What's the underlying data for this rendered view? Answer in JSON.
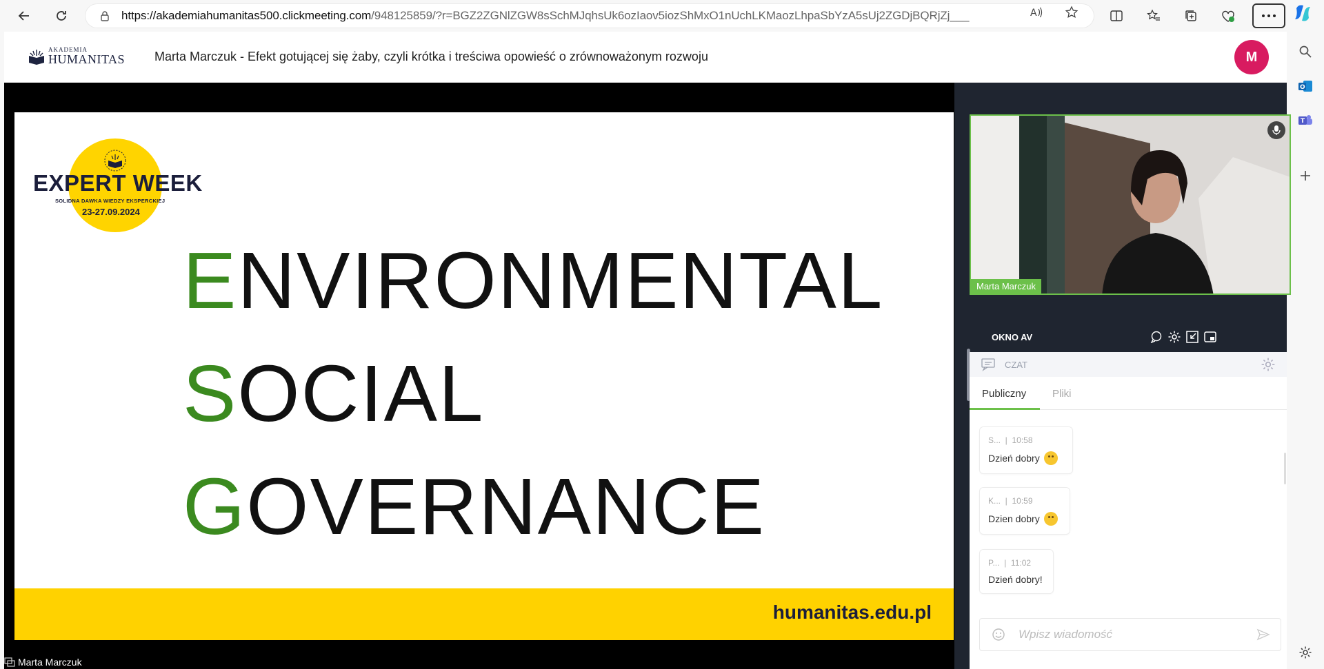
{
  "browser": {
    "url_host": "https://akademiahumanitas500.clickmeeting.com",
    "url_path": "/948125859/?r=BGZ2ZGNlZGW8sSchMJqhsUk6ozIaov5iozShMxO1nUchLKMaozLhpaSbYzA5sUj2ZGDjBQRjZj___"
  },
  "header": {
    "logo_line1": "AKADEMIA",
    "logo_line2": "HUMANITAS",
    "title": "Marta Marczuk - Efekt gotującej się żaby, czyli krótka i treściwa opowieść o zrównoważonym rozwoju",
    "avatar_initial": "M"
  },
  "slide": {
    "badge_title": "EXPERT WEEK",
    "badge_subtitle": "SOLIDNA DAWKA WIEDZY EKSPERCKIEJ",
    "badge_dates": "23-27.09.2024",
    "line1_initial": "E",
    "line1_rest": "NVIRONMENTAL",
    "line2_initial": "S",
    "line2_rest": "OCIAL",
    "line3_initial": "G",
    "line3_rest": "OVERNANCE",
    "website": "humanitas.edu.pl",
    "presenter_label": "Marta Marczuk"
  },
  "video": {
    "participant_name": "Marta Marczuk"
  },
  "av_panel": {
    "label": "OKNO AV"
  },
  "chat": {
    "header_label": "CZAT",
    "tabs": [
      {
        "label": "Publiczny"
      },
      {
        "label": "Pliki"
      }
    ],
    "messages": [
      {
        "author": "S...",
        "time": "10:58",
        "text": "Dzień dobry"
      },
      {
        "author": "K...",
        "time": "10:59",
        "text": "Dzien dobry"
      },
      {
        "author": "P...",
        "time": "11:02",
        "text": "Dzień dobry!"
      }
    ],
    "input_placeholder": "Wpisz wiadomość"
  },
  "colors": {
    "accent_green": "#6cc04a",
    "esg_green": "#3b8a1f",
    "brand_yellow": "#ffd200",
    "avatar_pink": "#d81b60"
  }
}
